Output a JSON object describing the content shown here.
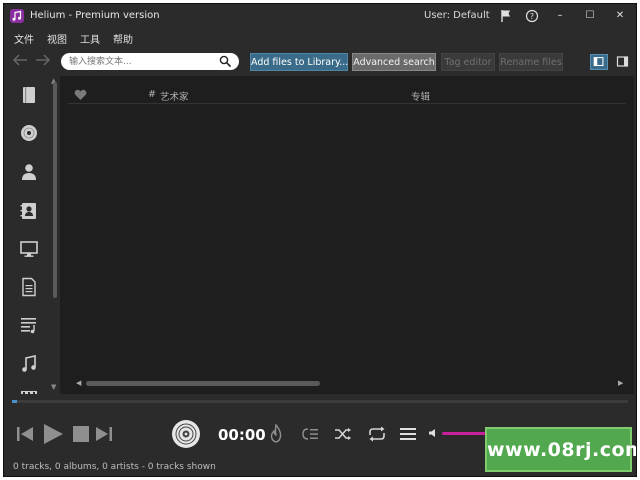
{
  "window": {
    "title": "Helium - Premium version",
    "user_label": "User: Default",
    "controls": {
      "minimize": "–",
      "maximize": "☐",
      "close": "✕"
    }
  },
  "menu": [
    "文件",
    "视图",
    "工具",
    "帮助"
  ],
  "toolbar": {
    "search_placeholder": "输入搜索文本...",
    "add_files": "Add files to Library...",
    "advanced_search": "Advanced search",
    "tag_editor": "Tag editor",
    "rename_files": "Rename files"
  },
  "sidebar": {
    "items": [
      {
        "icon": "book-icon"
      },
      {
        "icon": "disc-icon"
      },
      {
        "icon": "person-icon"
      },
      {
        "icon": "contact-book-icon"
      },
      {
        "icon": "monitor-icon"
      },
      {
        "icon": "document-icon"
      },
      {
        "icon": "playlist-icon"
      },
      {
        "icon": "music-note-icon"
      },
      {
        "icon": "film-icon"
      }
    ]
  },
  "table": {
    "columns": [
      "#",
      "艺术家",
      "专辑"
    ]
  },
  "player": {
    "time": "00:00",
    "volume_fraction": 0.55
  },
  "status": "0 tracks, 0 albums, 0 artists - 0 tracks shown",
  "watermark": "www.08rj.com",
  "colors": {
    "accent": "#3a6c8a",
    "volume": "#c8219e",
    "watermark_bg": "#52a84f"
  }
}
